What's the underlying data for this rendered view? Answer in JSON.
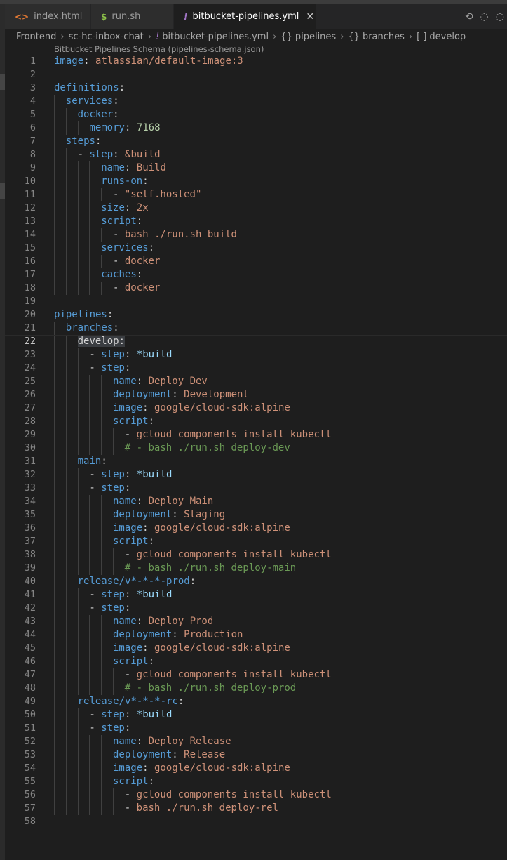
{
  "tabs": [
    {
      "icon": "<>",
      "label": "index.html",
      "active": false
    },
    {
      "icon": "$",
      "label": "run.sh",
      "active": false
    },
    {
      "icon": "!",
      "label": "bitbucket-pipelines.yml",
      "active": true
    }
  ],
  "breadcrumb": {
    "items": [
      "Frontend",
      "sc-hc-inbox-chat",
      "bitbucket-pipelines.yml",
      "pipelines",
      "branches",
      "develop"
    ],
    "symbols": [
      "",
      "",
      "!",
      "{}",
      "{}",
      "[ ]"
    ]
  },
  "schema_label": "Bitbucket Pipelines Schema (pipelines-schema.json)",
  "current_line": 22,
  "lines": [
    {
      "n": "1",
      "ind": 0,
      "t": [
        [
          "k",
          "image"
        ],
        [
          "p",
          ": "
        ],
        [
          "v",
          "atlassian/default-image:3"
        ]
      ]
    },
    {
      "n": "2",
      "ind": 0,
      "t": []
    },
    {
      "n": "3",
      "ind": 0,
      "t": [
        [
          "k",
          "definitions"
        ],
        [
          "p",
          ":"
        ]
      ]
    },
    {
      "n": "4",
      "ind": 1,
      "t": [
        [
          "k",
          "services"
        ],
        [
          "p",
          ":"
        ]
      ]
    },
    {
      "n": "5",
      "ind": 2,
      "t": [
        [
          "k",
          "docker"
        ],
        [
          "p",
          ":"
        ]
      ]
    },
    {
      "n": "6",
      "ind": 3,
      "t": [
        [
          "k",
          "memory"
        ],
        [
          "p",
          ": "
        ],
        [
          "n",
          "7168"
        ]
      ]
    },
    {
      "n": "7",
      "ind": 1,
      "t": [
        [
          "k",
          "steps"
        ],
        [
          "p",
          ":"
        ]
      ]
    },
    {
      "n": "8",
      "ind": 2,
      "t": [
        [
          "p",
          "- "
        ],
        [
          "k",
          "step"
        ],
        [
          "p",
          ": "
        ],
        [
          "anc",
          "&build"
        ]
      ]
    },
    {
      "n": "9",
      "ind": 4,
      "t": [
        [
          "k",
          "name"
        ],
        [
          "p",
          ": "
        ],
        [
          "v",
          "Build"
        ]
      ]
    },
    {
      "n": "10",
      "ind": 4,
      "t": [
        [
          "k",
          "runs-on"
        ],
        [
          "p",
          ":"
        ]
      ]
    },
    {
      "n": "11",
      "ind": 5,
      "t": [
        [
          "p",
          "- "
        ],
        [
          "v",
          "\"self.hosted\""
        ]
      ]
    },
    {
      "n": "12",
      "ind": 4,
      "t": [
        [
          "k",
          "size"
        ],
        [
          "p",
          ": "
        ],
        [
          "v",
          "2x"
        ]
      ]
    },
    {
      "n": "13",
      "ind": 4,
      "t": [
        [
          "k",
          "script"
        ],
        [
          "p",
          ":"
        ]
      ]
    },
    {
      "n": "14",
      "ind": 5,
      "t": [
        [
          "p",
          "- "
        ],
        [
          "v",
          "bash ./run.sh build"
        ]
      ]
    },
    {
      "n": "15",
      "ind": 4,
      "t": [
        [
          "k",
          "services"
        ],
        [
          "p",
          ":"
        ]
      ]
    },
    {
      "n": "16",
      "ind": 5,
      "t": [
        [
          "p",
          "- "
        ],
        [
          "v",
          "docker"
        ]
      ]
    },
    {
      "n": "17",
      "ind": 4,
      "t": [
        [
          "k",
          "caches"
        ],
        [
          "p",
          ":"
        ]
      ]
    },
    {
      "n": "18",
      "ind": 5,
      "t": [
        [
          "p",
          "- "
        ],
        [
          "v",
          "docker"
        ]
      ]
    },
    {
      "n": "19",
      "ind": 0,
      "t": []
    },
    {
      "n": "20",
      "ind": 0,
      "t": [
        [
          "k",
          "pipelines"
        ],
        [
          "p",
          ":"
        ]
      ]
    },
    {
      "n": "21",
      "ind": 1,
      "t": [
        [
          "k",
          "branches"
        ],
        [
          "p",
          ":"
        ]
      ]
    },
    {
      "n": "22",
      "ind": 2,
      "t": [
        [
          "hl",
          "develop:"
        ]
      ]
    },
    {
      "n": "23",
      "ind": 3,
      "t": [
        [
          "p",
          "- "
        ],
        [
          "k",
          "step"
        ],
        [
          "p",
          ": "
        ],
        [
          "a",
          "*build"
        ]
      ]
    },
    {
      "n": "24",
      "ind": 3,
      "t": [
        [
          "p",
          "- "
        ],
        [
          "k",
          "step"
        ],
        [
          "p",
          ":"
        ]
      ]
    },
    {
      "n": "25",
      "ind": 5,
      "t": [
        [
          "k",
          "name"
        ],
        [
          "p",
          ": "
        ],
        [
          "v",
          "Deploy Dev"
        ]
      ]
    },
    {
      "n": "26",
      "ind": 5,
      "t": [
        [
          "k",
          "deployment"
        ],
        [
          "p",
          ": "
        ],
        [
          "v",
          "Development"
        ]
      ]
    },
    {
      "n": "27",
      "ind": 5,
      "t": [
        [
          "k",
          "image"
        ],
        [
          "p",
          ": "
        ],
        [
          "v",
          "google/cloud-sdk:alpine"
        ]
      ]
    },
    {
      "n": "28",
      "ind": 5,
      "t": [
        [
          "k",
          "script"
        ],
        [
          "p",
          ":"
        ]
      ]
    },
    {
      "n": "29",
      "ind": 6,
      "t": [
        [
          "p",
          "- "
        ],
        [
          "v",
          "gcloud components install kubectl"
        ]
      ]
    },
    {
      "n": "30",
      "ind": 6,
      "t": [
        [
          "c",
          "# - bash ./run.sh deploy-dev"
        ]
      ]
    },
    {
      "n": "31",
      "ind": 2,
      "t": [
        [
          "k",
          "main"
        ],
        [
          "p",
          ":"
        ]
      ]
    },
    {
      "n": "32",
      "ind": 3,
      "t": [
        [
          "p",
          "- "
        ],
        [
          "k",
          "step"
        ],
        [
          "p",
          ": "
        ],
        [
          "a",
          "*build"
        ]
      ]
    },
    {
      "n": "33",
      "ind": 3,
      "t": [
        [
          "p",
          "- "
        ],
        [
          "k",
          "step"
        ],
        [
          "p",
          ":"
        ]
      ]
    },
    {
      "n": "34",
      "ind": 5,
      "t": [
        [
          "k",
          "name"
        ],
        [
          "p",
          ": "
        ],
        [
          "v",
          "Deploy Main"
        ]
      ]
    },
    {
      "n": "35",
      "ind": 5,
      "t": [
        [
          "k",
          "deployment"
        ],
        [
          "p",
          ": "
        ],
        [
          "v",
          "Staging"
        ]
      ]
    },
    {
      "n": "36",
      "ind": 5,
      "t": [
        [
          "k",
          "image"
        ],
        [
          "p",
          ": "
        ],
        [
          "v",
          "google/cloud-sdk:alpine"
        ]
      ]
    },
    {
      "n": "37",
      "ind": 5,
      "t": [
        [
          "k",
          "script"
        ],
        [
          "p",
          ":"
        ]
      ]
    },
    {
      "n": "38",
      "ind": 6,
      "t": [
        [
          "p",
          "- "
        ],
        [
          "v",
          "gcloud components install kubectl"
        ]
      ]
    },
    {
      "n": "39",
      "ind": 6,
      "t": [
        [
          "c",
          "# - bash ./run.sh deploy-main"
        ]
      ]
    },
    {
      "n": "40",
      "ind": 2,
      "t": [
        [
          "k",
          "release/v*-*-*-prod"
        ],
        [
          "p",
          ":"
        ]
      ]
    },
    {
      "n": "41",
      "ind": 3,
      "t": [
        [
          "p",
          "- "
        ],
        [
          "k",
          "step"
        ],
        [
          "p",
          ": "
        ],
        [
          "a",
          "*build"
        ]
      ]
    },
    {
      "n": "42",
      "ind": 3,
      "t": [
        [
          "p",
          "- "
        ],
        [
          "k",
          "step"
        ],
        [
          "p",
          ":"
        ]
      ]
    },
    {
      "n": "43",
      "ind": 5,
      "t": [
        [
          "k",
          "name"
        ],
        [
          "p",
          ": "
        ],
        [
          "v",
          "Deploy Prod"
        ]
      ]
    },
    {
      "n": "44",
      "ind": 5,
      "t": [
        [
          "k",
          "deployment"
        ],
        [
          "p",
          ": "
        ],
        [
          "v",
          "Production"
        ]
      ]
    },
    {
      "n": "45",
      "ind": 5,
      "t": [
        [
          "k",
          "image"
        ],
        [
          "p",
          ": "
        ],
        [
          "v",
          "google/cloud-sdk:alpine"
        ]
      ]
    },
    {
      "n": "46",
      "ind": 5,
      "t": [
        [
          "k",
          "script"
        ],
        [
          "p",
          ":"
        ]
      ]
    },
    {
      "n": "47",
      "ind": 6,
      "t": [
        [
          "p",
          "- "
        ],
        [
          "v",
          "gcloud components install kubectl"
        ]
      ]
    },
    {
      "n": "48",
      "ind": 6,
      "t": [
        [
          "c",
          "# - bash ./run.sh deploy-prod"
        ]
      ]
    },
    {
      "n": "49",
      "ind": 2,
      "t": [
        [
          "k",
          "release/v*-*-*-rc"
        ],
        [
          "p",
          ":"
        ]
      ]
    },
    {
      "n": "50",
      "ind": 3,
      "t": [
        [
          "p",
          "- "
        ],
        [
          "k",
          "step"
        ],
        [
          "p",
          ": "
        ],
        [
          "a",
          "*build"
        ]
      ]
    },
    {
      "n": "51",
      "ind": 3,
      "t": [
        [
          "p",
          "- "
        ],
        [
          "k",
          "step"
        ],
        [
          "p",
          ":"
        ]
      ]
    },
    {
      "n": "52",
      "ind": 5,
      "t": [
        [
          "k",
          "name"
        ],
        [
          "p",
          ": "
        ],
        [
          "v",
          "Deploy Release"
        ]
      ]
    },
    {
      "n": "53",
      "ind": 5,
      "t": [
        [
          "k",
          "deployment"
        ],
        [
          "p",
          ": "
        ],
        [
          "v",
          "Release"
        ]
      ]
    },
    {
      "n": "54",
      "ind": 5,
      "t": [
        [
          "k",
          "image"
        ],
        [
          "p",
          ": "
        ],
        [
          "v",
          "google/cloud-sdk:alpine"
        ]
      ]
    },
    {
      "n": "55",
      "ind": 5,
      "t": [
        [
          "k",
          "script"
        ],
        [
          "p",
          ":"
        ]
      ]
    },
    {
      "n": "56",
      "ind": 6,
      "t": [
        [
          "p",
          "- "
        ],
        [
          "v",
          "gcloud components install kubectl"
        ]
      ]
    },
    {
      "n": "57",
      "ind": 6,
      "t": [
        [
          "p",
          "- "
        ],
        [
          "v",
          "bash ./run.sh deploy-rel"
        ]
      ]
    },
    {
      "n": "58",
      "ind": 0,
      "t": []
    }
  ]
}
